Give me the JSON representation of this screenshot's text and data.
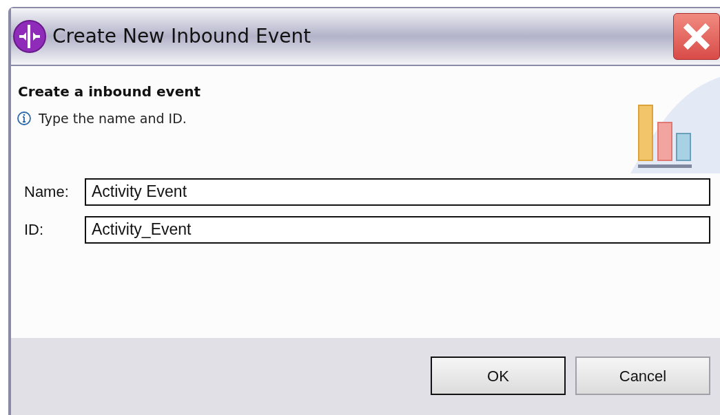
{
  "window": {
    "title": "Create New Inbound Event"
  },
  "header": {
    "title": "Create a inbound event",
    "message": "Type the name and ID."
  },
  "fields": [
    {
      "label": "Name:",
      "value": "Activity Event"
    },
    {
      "label": "ID:",
      "value": "Activity_Event"
    }
  ],
  "buttons": [
    {
      "label": "OK",
      "default": true
    },
    {
      "label": "Cancel",
      "default": false
    }
  ]
}
